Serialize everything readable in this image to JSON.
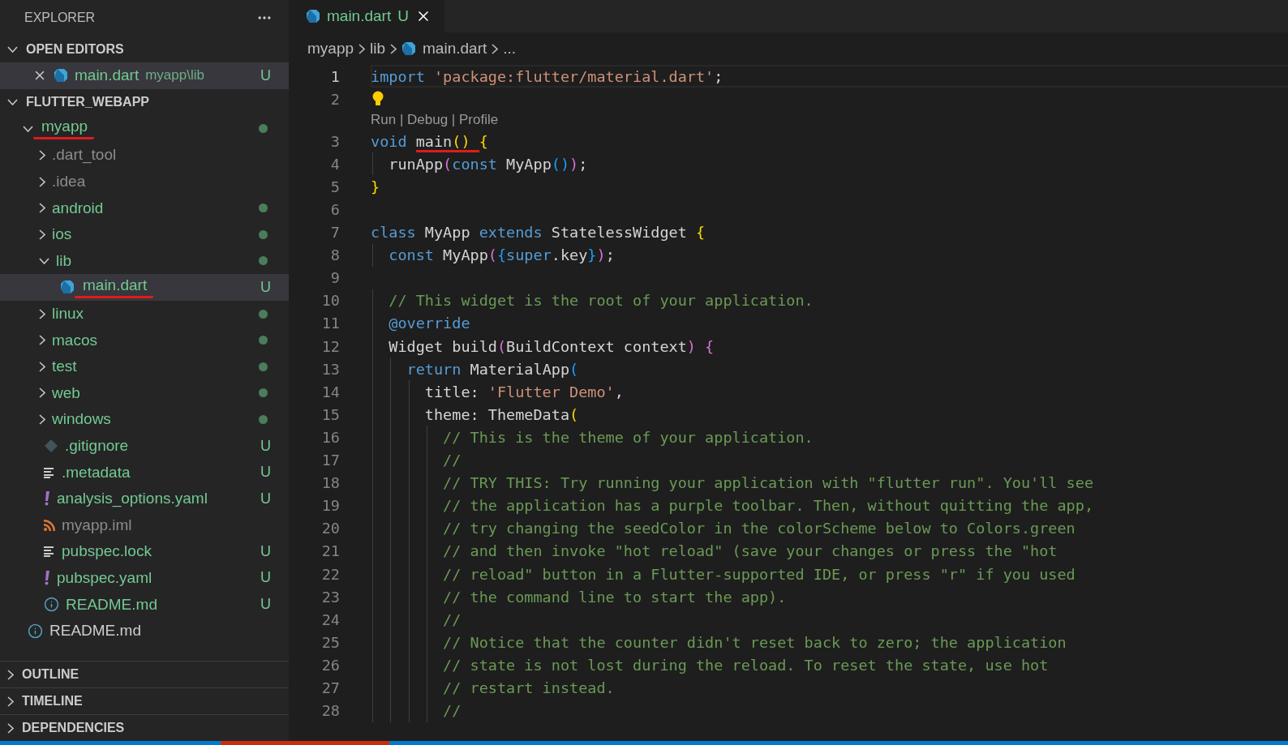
{
  "sidebar": {
    "title": "EXPLORER",
    "open_editors": {
      "title": "OPEN EDITORS",
      "expanded": true,
      "items": [
        {
          "label": "main.dart",
          "description": "myapp\\lib",
          "badge": "U",
          "kind": "dart",
          "selected": true
        }
      ]
    },
    "workspace": {
      "title": "FLUTTER_WEBAPP",
      "expanded": true,
      "tree": [
        {
          "label": "myapp",
          "kind": "folder",
          "expanded": true,
          "untracked": true,
          "ignored": false,
          "has_changes": true,
          "underlined": true,
          "selected": false,
          "children": [
            {
              "label": ".dart_tool",
              "kind": "folder",
              "expanded": false,
              "ignored": true,
              "has_changes": false,
              "selected": false
            },
            {
              "label": ".idea",
              "kind": "folder",
              "expanded": false,
              "ignored": true,
              "has_changes": false,
              "selected": false
            },
            {
              "label": "android",
              "kind": "folder",
              "expanded": false,
              "untracked": true,
              "ignored": false,
              "has_changes": true,
              "selected": false
            },
            {
              "label": "ios",
              "kind": "folder",
              "expanded": false,
              "untracked": true,
              "ignored": false,
              "has_changes": true,
              "selected": false
            },
            {
              "label": "lib",
              "kind": "folder",
              "expanded": true,
              "untracked": true,
              "ignored": false,
              "has_changes": true,
              "selected": false,
              "children": [
                {
                  "label": "main.dart",
                  "kind": "dart",
                  "untracked": true,
                  "ignored": false,
                  "badge": "U",
                  "underlined": true,
                  "selected": true
                }
              ]
            },
            {
              "label": "linux",
              "kind": "folder",
              "expanded": false,
              "untracked": true,
              "ignored": false,
              "has_changes": true,
              "selected": false
            },
            {
              "label": "macos",
              "kind": "folder",
              "expanded": false,
              "untracked": true,
              "ignored": false,
              "has_changes": true,
              "selected": false
            },
            {
              "label": "test",
              "kind": "folder",
              "expanded": false,
              "untracked": true,
              "ignored": false,
              "has_changes": true,
              "selected": false
            },
            {
              "label": "web",
              "kind": "folder",
              "expanded": false,
              "untracked": true,
              "ignored": false,
              "has_changes": true,
              "selected": false
            },
            {
              "label": "windows",
              "kind": "folder",
              "expanded": false,
              "untracked": true,
              "ignored": false,
              "has_changes": true,
              "selected": false
            },
            {
              "label": ".gitignore",
              "kind": "git",
              "untracked": true,
              "ignored": false,
              "badge": "U",
              "selected": false
            },
            {
              "label": ".metadata",
              "kind": "text",
              "untracked": true,
              "ignored": false,
              "badge": "U",
              "selected": false
            },
            {
              "label": "analysis_options.yaml",
              "kind": "yaml",
              "untracked": true,
              "ignored": false,
              "badge": "U",
              "selected": false
            },
            {
              "label": "myapp.iml",
              "kind": "xml",
              "ignored": true,
              "selected": false
            },
            {
              "label": "pubspec.lock",
              "kind": "text",
              "untracked": true,
              "ignored": false,
              "badge": "U",
              "selected": false
            },
            {
              "label": "pubspec.yaml",
              "kind": "yaml",
              "untracked": true,
              "ignored": false,
              "badge": "U",
              "selected": false
            },
            {
              "label": "README.md",
              "kind": "info",
              "untracked": true,
              "ignored": false,
              "badge": "U",
              "selected": false
            }
          ]
        },
        {
          "label": "README.md",
          "kind": "info",
          "untracked": false,
          "ignored": false,
          "selected": false
        }
      ]
    },
    "panels": [
      {
        "title": "OUTLINE",
        "expanded": false
      },
      {
        "title": "TIMELINE",
        "expanded": false
      },
      {
        "title": "DEPENDENCIES",
        "expanded": false
      }
    ]
  },
  "editor": {
    "tabs": [
      {
        "label": "main.dart",
        "badge": "U",
        "kind": "dart",
        "selected": true
      }
    ],
    "breadcrumbs": [
      {
        "label": "myapp",
        "kind": "folder"
      },
      {
        "label": "lib",
        "kind": "folder"
      },
      {
        "label": "main.dart",
        "kind": "dart"
      },
      {
        "label": "...",
        "kind": "symbol"
      }
    ],
    "lines": [
      {
        "kind": "code",
        "number": "1",
        "current": true,
        "tokens": [
          {
            "kind": "kw",
            "s": "import"
          },
          {
            "kind": "str",
            "s": " 'package:flutter/material.dart'"
          },
          {
            "kind": "plain",
            "s": ";"
          }
        ]
      },
      {
        "kind": "code",
        "number": "2",
        "current": false,
        "lightbulb": true
      },
      {
        "kind": "codelens",
        "text": "Run | Debug | Profile"
      },
      {
        "kind": "code",
        "number": "3",
        "current": false,
        "tokens": [
          {
            "kind": "kw",
            "s": "void "
          },
          {
            "kind": "plain",
            "s": "main",
            "underlined": true
          },
          {
            "kind": "b1",
            "s": "() ",
            "underlined": true
          },
          {
            "kind": "b1",
            "s": "{"
          }
        ]
      },
      {
        "kind": "code",
        "number": "4",
        "current": false,
        "tokens": [
          {
            "kind": "plain",
            "s": "  runApp"
          },
          {
            "kind": "b2",
            "s": "("
          },
          {
            "kind": "kw",
            "s": "const"
          },
          {
            "kind": "plain",
            "s": " MyApp"
          },
          {
            "kind": "b3",
            "s": "()"
          },
          {
            "kind": "b2",
            "s": ")"
          },
          {
            "kind": "plain",
            "s": ";"
          }
        ]
      },
      {
        "kind": "code",
        "number": "5",
        "current": false,
        "tokens": [
          {
            "kind": "b1",
            "s": "}"
          }
        ]
      },
      {
        "kind": "code",
        "number": "6",
        "current": false
      },
      {
        "kind": "code",
        "number": "7",
        "current": false,
        "tokens": [
          {
            "kind": "kw",
            "s": "class"
          },
          {
            "kind": "plain",
            "s": " MyApp "
          },
          {
            "kind": "kw",
            "s": "extends"
          },
          {
            "kind": "plain",
            "s": " StatelessWidget "
          },
          {
            "kind": "b1",
            "s": "{"
          }
        ]
      },
      {
        "kind": "code",
        "number": "8",
        "current": false,
        "tokens": [
          {
            "kind": "kw",
            "s": "  const"
          },
          {
            "kind": "plain",
            "s": " MyApp"
          },
          {
            "kind": "b2",
            "s": "("
          },
          {
            "kind": "b3",
            "s": "{"
          },
          {
            "kind": "kw",
            "s": "super"
          },
          {
            "kind": "plain",
            "s": ".key"
          },
          {
            "kind": "b3",
            "s": "}"
          },
          {
            "kind": "b2",
            "s": ")"
          },
          {
            "kind": "plain",
            "s": ";"
          }
        ]
      },
      {
        "kind": "code",
        "number": "9",
        "current": false
      },
      {
        "kind": "code",
        "number": "10",
        "current": false,
        "tokens": [
          {
            "kind": "cmt",
            "s": "  // This widget is the root of your application."
          }
        ]
      },
      {
        "kind": "code",
        "number": "11",
        "current": false,
        "tokens": [
          {
            "kind": "kw",
            "s": "  @override"
          }
        ]
      },
      {
        "kind": "code",
        "number": "12",
        "current": false,
        "tokens": [
          {
            "kind": "plain",
            "s": "  Widget build"
          },
          {
            "kind": "b2",
            "s": "("
          },
          {
            "kind": "plain",
            "s": "BuildContext context"
          },
          {
            "kind": "b2",
            "s": ")"
          },
          {
            "kind": "b2",
            "s": " {"
          }
        ]
      },
      {
        "kind": "code",
        "number": "13",
        "current": false,
        "tokens": [
          {
            "kind": "kw",
            "s": "    return"
          },
          {
            "kind": "plain",
            "s": " MaterialApp"
          },
          {
            "kind": "b3",
            "s": "("
          }
        ]
      },
      {
        "kind": "code",
        "number": "14",
        "current": false,
        "tokens": [
          {
            "kind": "plain",
            "s": "      title: "
          },
          {
            "kind": "str",
            "s": "'Flutter Demo'"
          },
          {
            "kind": "plain",
            "s": ","
          }
        ]
      },
      {
        "kind": "code",
        "number": "15",
        "current": false,
        "tokens": [
          {
            "kind": "plain",
            "s": "      theme: ThemeData"
          },
          {
            "kind": "b1",
            "s": "("
          }
        ]
      },
      {
        "kind": "code",
        "number": "16",
        "current": false,
        "tokens": [
          {
            "kind": "cmt",
            "s": "        // This is the theme of your application."
          }
        ]
      },
      {
        "kind": "code",
        "number": "17",
        "current": false,
        "tokens": [
          {
            "kind": "cmt",
            "s": "        //"
          }
        ]
      },
      {
        "kind": "code",
        "number": "18",
        "current": false,
        "tokens": [
          {
            "kind": "cmt",
            "s": "        // TRY THIS: Try running your application with \"flutter run\". You'll see"
          }
        ]
      },
      {
        "kind": "code",
        "number": "19",
        "current": false,
        "tokens": [
          {
            "kind": "cmt",
            "s": "        // the application has a purple toolbar. Then, without quitting the app,"
          }
        ]
      },
      {
        "kind": "code",
        "number": "20",
        "current": false,
        "tokens": [
          {
            "kind": "cmt",
            "s": "        // try changing the seedColor in the colorScheme below to Colors.green"
          }
        ]
      },
      {
        "kind": "code",
        "number": "21",
        "current": false,
        "tokens": [
          {
            "kind": "cmt",
            "s": "        // and then invoke \"hot reload\" (save your changes or press the \"hot"
          }
        ]
      },
      {
        "kind": "code",
        "number": "22",
        "current": false,
        "tokens": [
          {
            "kind": "cmt",
            "s": "        // reload\" button in a Flutter-supported IDE, or press \"r\" if you used"
          }
        ]
      },
      {
        "kind": "code",
        "number": "23",
        "current": false,
        "tokens": [
          {
            "kind": "cmt",
            "s": "        // the command line to start the app)."
          }
        ]
      },
      {
        "kind": "code",
        "number": "24",
        "current": false,
        "tokens": [
          {
            "kind": "cmt",
            "s": "        //"
          }
        ]
      },
      {
        "kind": "code",
        "number": "25",
        "current": false,
        "tokens": [
          {
            "kind": "cmt",
            "s": "        // Notice that the counter didn't reset back to zero; the application"
          }
        ]
      },
      {
        "kind": "code",
        "number": "26",
        "current": false,
        "tokens": [
          {
            "kind": "cmt",
            "s": "        // state is not lost during the reload. To reset the state, use hot"
          }
        ]
      },
      {
        "kind": "code",
        "number": "27",
        "current": false,
        "tokens": [
          {
            "kind": "cmt",
            "s": "        // restart instead."
          }
        ]
      },
      {
        "kind": "code",
        "number": "28",
        "current": false,
        "tokens": [
          {
            "kind": "cmt",
            "s": "        //"
          }
        ]
      }
    ]
  }
}
